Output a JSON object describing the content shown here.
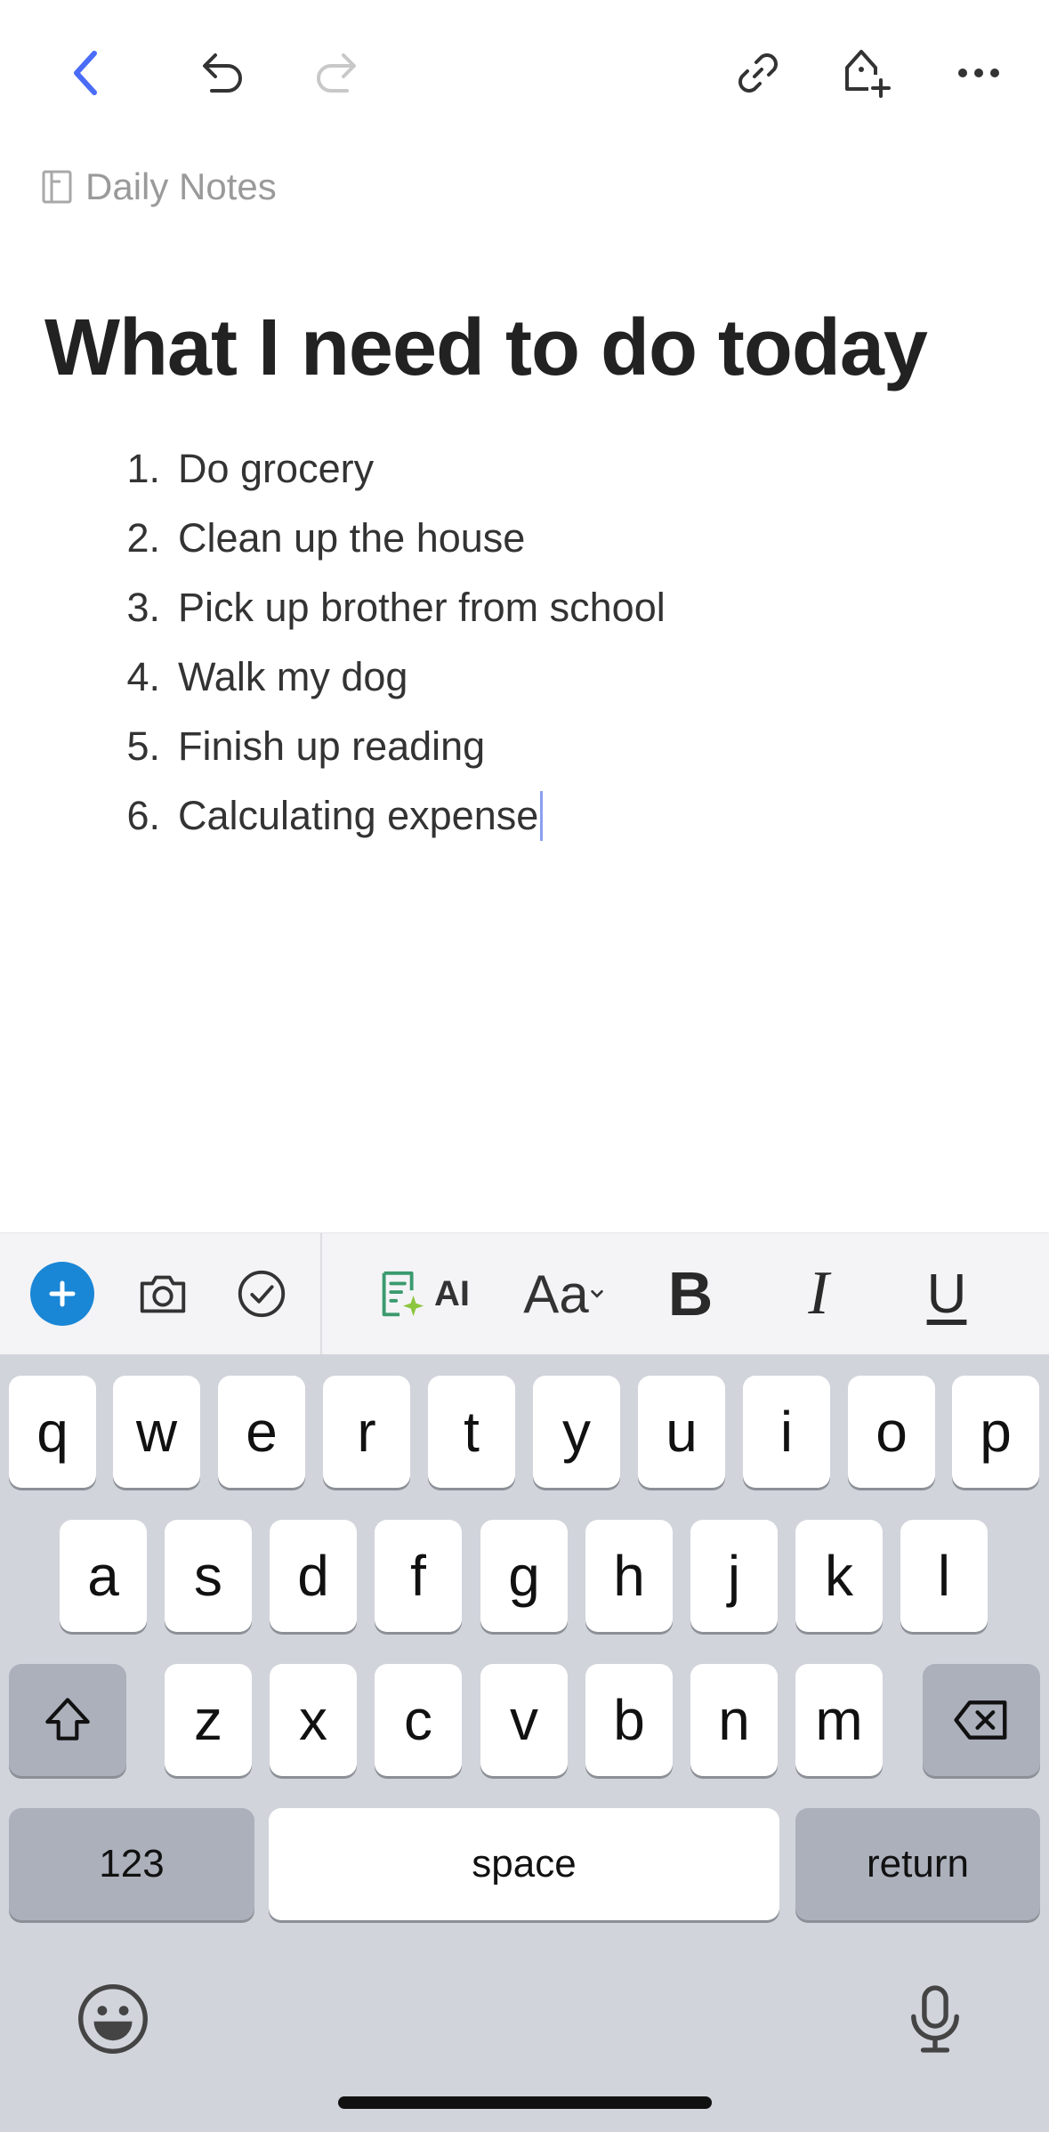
{
  "toolbar": {
    "back_icon": "chevron-left-icon",
    "undo_icon": "undo-icon",
    "redo_icon": "redo-icon",
    "link_icon": "link-icon",
    "share_icon": "share-icon",
    "more_icon": "more-icon"
  },
  "breadcrumb": {
    "label": "Daily Notes"
  },
  "page": {
    "title": "What I need to do today"
  },
  "list": {
    "items": [
      {
        "num": "1.",
        "text": "Do grocery"
      },
      {
        "num": "2.",
        "text": "Clean up the house"
      },
      {
        "num": "3.",
        "text": "Pick up brother from school"
      },
      {
        "num": "4.",
        "text": "Walk my dog"
      },
      {
        "num": "5.",
        "text": "Finish up reading"
      },
      {
        "num": "6.",
        "text": "Calculating expense"
      }
    ]
  },
  "format_toolbar": {
    "ai_label": "AI",
    "text_style_label": "Aa",
    "bold_label": "B",
    "italic_label": "I",
    "underline_label": "U"
  },
  "keyboard": {
    "row1": [
      "q",
      "w",
      "e",
      "r",
      "t",
      "y",
      "u",
      "i",
      "o",
      "p"
    ],
    "row2": [
      "a",
      "s",
      "d",
      "f",
      "g",
      "h",
      "j",
      "k",
      "l"
    ],
    "row3": [
      "z",
      "x",
      "c",
      "v",
      "b",
      "n",
      "m"
    ],
    "numbers_label": "123",
    "space_label": "space",
    "return_label": "return"
  },
  "colors": {
    "accent": "#4a6cf7",
    "plus_button": "#1a86d6",
    "keyboard_bg": "#d1d4db"
  }
}
